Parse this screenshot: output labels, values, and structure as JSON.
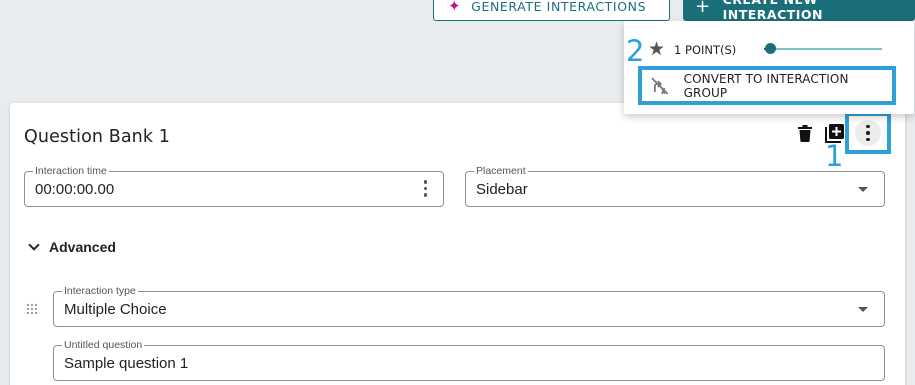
{
  "toolbar": {
    "generate_label": "GENERATE INTERACTIONS",
    "create_label": "CREATE NEW INTERACTION"
  },
  "card": {
    "title": "Question Bank 1",
    "interaction_time": {
      "label": "Interaction time",
      "value": "00:00:00.00"
    },
    "placement": {
      "label": "Placement",
      "value": "Sidebar"
    },
    "advanced_label": "Advanced",
    "interaction_type": {
      "label": "Interaction type",
      "value": "Multiple Choice"
    },
    "question": {
      "label": "Untitled question",
      "value": "Sample question 1"
    }
  },
  "menu": {
    "points_label": "1 POINT(S)",
    "points_value": 1,
    "convert_label": "CONVERT TO INTERACTION GROUP"
  },
  "annotations": {
    "step1": "1",
    "step2": "2",
    "highlight_color": "#2e9fd9"
  },
  "colors": {
    "primary": "#1b6f7a",
    "sparkle": "#c2148a"
  }
}
